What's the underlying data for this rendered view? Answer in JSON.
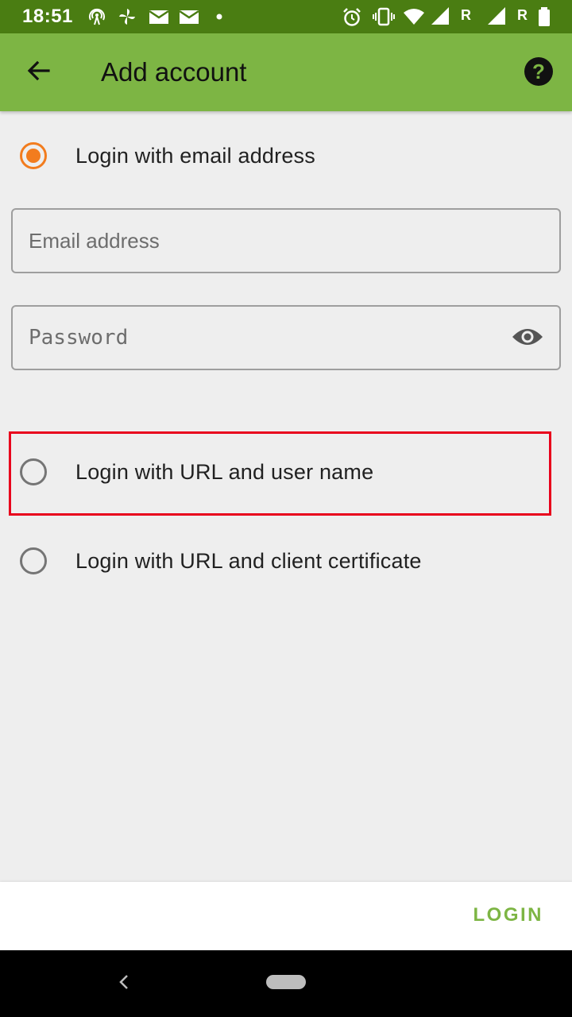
{
  "status_bar": {
    "time": "18:51",
    "roaming_1": "R",
    "roaming_2": "R",
    "icons": [
      "hotspot-icon",
      "pinwheel-icon",
      "mail-icon",
      "mail-icon",
      "dot-icon",
      "alarm-icon",
      "vibrate-icon",
      "wifi-icon",
      "signal-icon",
      "signal-icon",
      "battery-icon"
    ]
  },
  "app_bar": {
    "title": "Add account",
    "back_icon": "arrow-back-icon",
    "help_icon": "help-icon",
    "color": "#7db544"
  },
  "options": {
    "email": {
      "label": "Login with email address",
      "checked": true
    },
    "url_user": {
      "label": "Login with URL and user name",
      "checked": false
    },
    "url_cert": {
      "label": "Login with URL and client certificate",
      "checked": false
    }
  },
  "fields": {
    "email": {
      "placeholder": "Email address",
      "value": ""
    },
    "password": {
      "placeholder": "Password",
      "value": ""
    }
  },
  "bottom": {
    "login_label": "LOGIN"
  },
  "colors": {
    "accent": "#f27c1e",
    "primary": "#7db544",
    "status_bar": "#4a7d12",
    "highlight": "#e8001c"
  }
}
